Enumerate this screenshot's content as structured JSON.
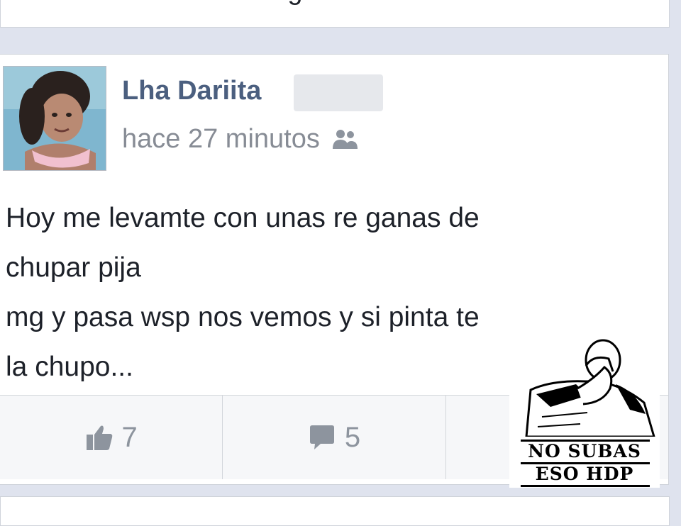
{
  "previous_post": {
    "text": "Pública en sus biografías."
  },
  "post": {
    "author": "Lha Dariita",
    "time": "hace 27 minutos",
    "privacy_icon": "friends-icon",
    "body_lines": [
      "Hoy me levamte con unas re ganas de",
      "chupar pija",
      "mg y pasa wsp nos vemos y si pinta te",
      "la chupo..."
    ]
  },
  "actions": {
    "like_count": "7",
    "comment_count": "5"
  },
  "meme": {
    "line1": "NO SUBAS",
    "line2": "ESO HDP"
  },
  "colors": {
    "author": "#4b5f7f",
    "time": "#878c95",
    "icon": "#8d949e",
    "background": "#dfe3ee"
  }
}
